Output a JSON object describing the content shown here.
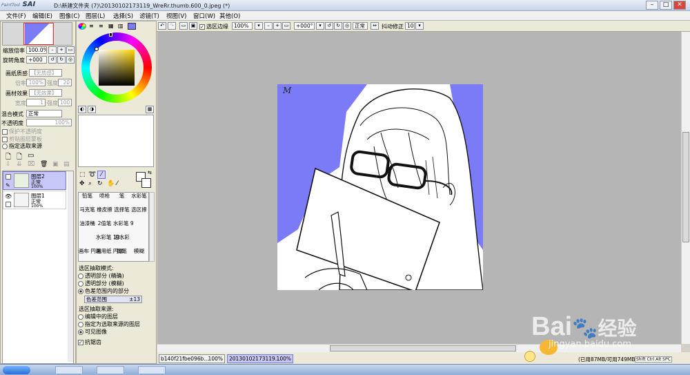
{
  "window": {
    "app_logo": "PaintTool",
    "app_name": "SAI",
    "title": "D:\\新建文件夹 (7)\\20130102173119_WreRr.thumb.600_0.jpeg (*)",
    "min": "–",
    "max": "□",
    "close": "✕"
  },
  "menu": [
    "文件(F)",
    "编辑(E)",
    "图像(C)",
    "图层(L)",
    "选择(S)",
    "滤镜(T)",
    "视图(V)",
    "窗口(W)",
    "其他(O)"
  ],
  "toolbar": {
    "zoom": "100%",
    "angle": "+000°",
    "mode": "正常",
    "selection_edge": "选区边缘",
    "stabilizer_label": "抖动修正",
    "stabilizer_value": "10"
  },
  "navigator": {
    "zoom_label": "缩放倍率",
    "zoom_value": "100.0%",
    "rotate_label": "旋转角度",
    "rotate_value": "+000"
  },
  "paper": {
    "texture_label": "画纸质感",
    "texture_value": "【无质感】",
    "scale_label": "倍率",
    "scale_value": "100%",
    "strength_label": "强度",
    "strength_value": "20",
    "effect_label": "画材效果",
    "effect_value": "【无效果】",
    "width_label": "宽度",
    "width_value": "1",
    "strength2_value": "100"
  },
  "layer_props": {
    "blend_label": "混合模式",
    "blend_value": "正常",
    "opacity_label": "不透明度",
    "opacity_value": "100%",
    "protect_alpha": "保护不透明度",
    "clip_group": "剪贴图层蒙板",
    "selection_source": "指定选取来源"
  },
  "layers": [
    {
      "name": "图层2",
      "mode": "正常",
      "opacity": "100%"
    },
    {
      "name": "图层1",
      "mode": "正常",
      "opacity": "100%"
    }
  ],
  "tools": [
    "铅笔",
    "喷枪",
    "笔",
    "水彩笔",
    "马克笔",
    "橡皮擦",
    "选择笔",
    "选区擦",
    "油漆桶",
    "2值笔",
    "水彩笔 9",
    "",
    "",
    "水彩笔 10",
    "旧水彩",
    "",
    "画布 円端",
    "画用纸 円端",
    "铅笔",
    "模糊"
  ],
  "magic_wand": {
    "mode_label": "选区抽取模式:",
    "mode_1": "透明部分 (精确)",
    "mode_2": "透明部分 (模糊)",
    "mode_3": "色差范围内的部分",
    "range_label": "色差范围",
    "range_value": "±13",
    "source_label": "选区抽取来源:",
    "source_1": "编辑中的图层",
    "source_2": "指定为选取来源的图层",
    "source_3": "可见图像",
    "antialias": "抗锯齿"
  },
  "tabs": [
    {
      "name": "b140f21fbe096b...",
      "zoom": "100%"
    },
    {
      "name": "20130102173119...",
      "zoom": "100%"
    }
  ],
  "status": {
    "memory": "(已用87MB/可用749MB)",
    "keys": "Shift Ctrl Alt SPC"
  },
  "canvas": {
    "signature": "M"
  },
  "watermark": {
    "brand": "Bai",
    "brand2": "经验",
    "url": "jingyan.baidu.com"
  },
  "colors": {
    "accent": "#7b7bf7",
    "panel": "#ece9d8",
    "canvas_bg": "#b5b5b5"
  }
}
